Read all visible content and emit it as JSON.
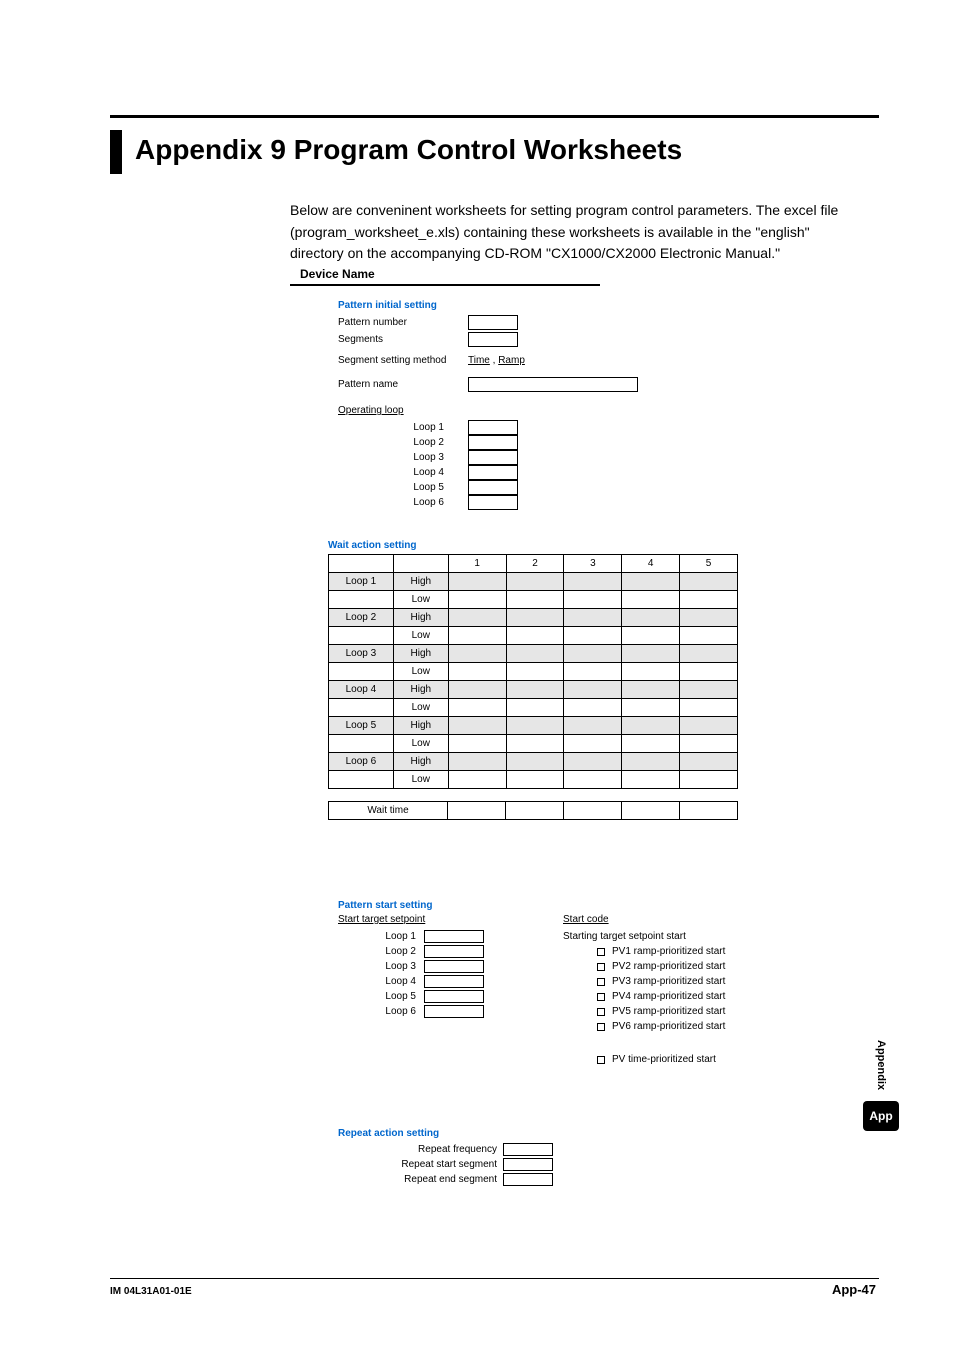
{
  "title": "Appendix 9  Program Control Worksheets",
  "intro": "Below are conveninent worksheets for setting program control parameters.  The excel file (program_worksheet_e.xls) containing these worksheets is available in the \"english\" directory on the accompanying CD-ROM \"CX1000/CX2000 Electronic Manual.\"",
  "device_name_label": "Device Name",
  "pattern_initial": {
    "heading": "Pattern initial setting",
    "pattern_number_label": "Pattern number",
    "segments_label": "Segments",
    "segment_method_label": "Segment setting method",
    "segment_method_opt1": "Time",
    "segment_method_opt2": "Ramp",
    "pattern_name_label": "Pattern name"
  },
  "operating_loop": {
    "heading": "Operating loop",
    "rows": [
      "Loop 1",
      "Loop 2",
      "Loop 3",
      "Loop 4",
      "Loop 5",
      "Loop 6"
    ]
  },
  "wait": {
    "heading": "Wait action setting",
    "cols": [
      "1",
      "2",
      "3",
      "4",
      "5"
    ],
    "rows": [
      {
        "loop": "Loop 1",
        "hl": "High"
      },
      {
        "loop": "",
        "hl": "Low"
      },
      {
        "loop": "Loop 2",
        "hl": "High"
      },
      {
        "loop": "",
        "hl": "Low"
      },
      {
        "loop": "Loop 3",
        "hl": "High"
      },
      {
        "loop": "",
        "hl": "Low"
      },
      {
        "loop": "Loop 4",
        "hl": "High"
      },
      {
        "loop": "",
        "hl": "Low"
      },
      {
        "loop": "Loop 5",
        "hl": "High"
      },
      {
        "loop": "",
        "hl": "Low"
      },
      {
        "loop": "Loop 6",
        "hl": "High"
      },
      {
        "loop": "",
        "hl": "Low"
      }
    ],
    "wait_time_label": "Wait time"
  },
  "pattern_start": {
    "heading": "Pattern start setting",
    "left_heading": "Start target setpoint",
    "loops": [
      "Loop 1",
      "Loop 2",
      "Loop 3",
      "Loop 4",
      "Loop 5",
      "Loop 6"
    ],
    "right_heading": "Start code",
    "top_option": "Starting target setpoint start",
    "options": [
      "PV1 ramp-prioritized start",
      "PV2 ramp-prioritized start",
      "PV3 ramp-prioritized start",
      "PV4 ramp-prioritized start",
      "PV5 ramp-prioritized start",
      "PV6 ramp-prioritized start"
    ],
    "last_option": "PV time-prioritized start"
  },
  "repeat": {
    "heading": "Repeat action setting",
    "rows": [
      "Repeat frequency",
      "Repeat start segment",
      "Repeat end segment"
    ]
  },
  "footer": {
    "left": "IM 04L31A01-01E",
    "right": "App-47"
  },
  "side": {
    "text": "Appendix",
    "tab": "App"
  }
}
